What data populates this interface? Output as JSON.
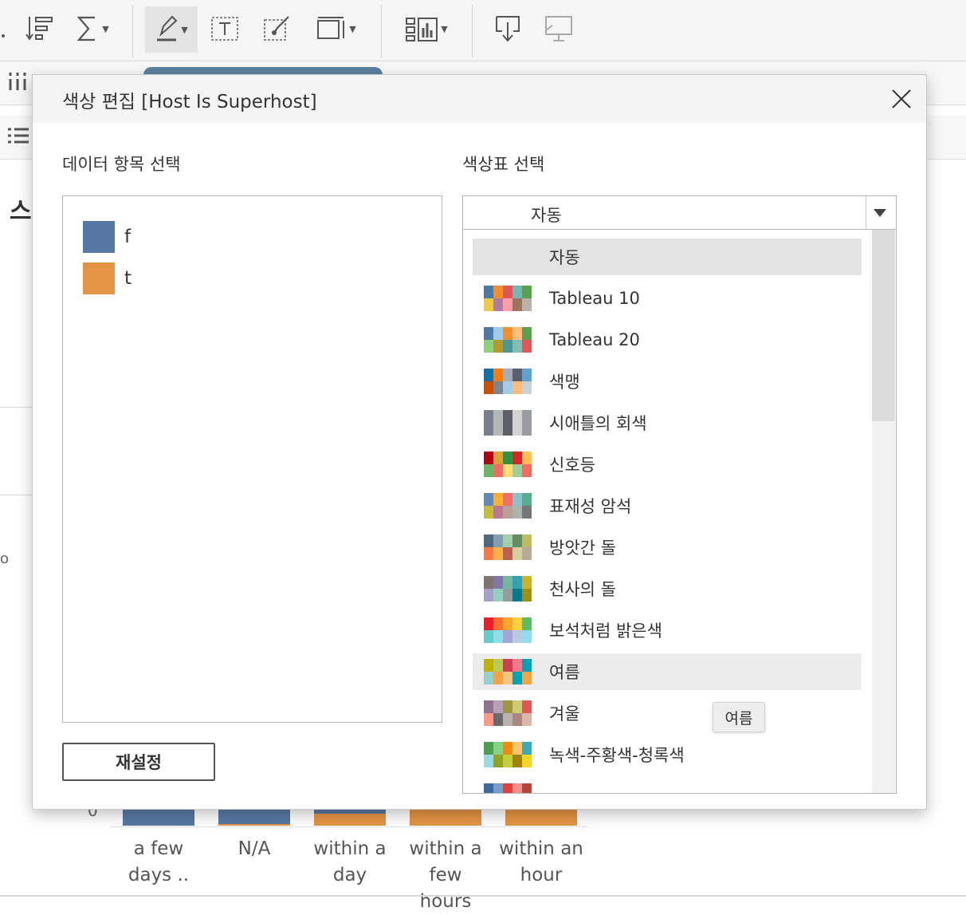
{
  "background": {
    "sheet_heading_partial": "스",
    "side_fragment": "o",
    "chart_zero": "0",
    "x_labels": [
      {
        "line1": "a few",
        "line2": "days .."
      },
      {
        "line1": "N/A",
        "line2": ""
      },
      {
        "line1": "within a",
        "line2": "day"
      },
      {
        "line1": "within a",
        "line2": "few hours"
      },
      {
        "line1": "within an",
        "line2": "hour"
      }
    ],
    "colors": {
      "f": "#5778a4",
      "t": "#e49444"
    }
  },
  "dialog": {
    "title": "색상 편집 [Host Is Superhost]",
    "data_items_label": "데이터 항목 선택",
    "palette_label": "색상표 선택",
    "items": [
      {
        "label": "f",
        "color": "#5778a4"
      },
      {
        "label": "t",
        "color": "#e49444"
      }
    ],
    "reset_label": "재설정",
    "selected_palette": "자동",
    "palettes": [
      {
        "label": "자동",
        "colors": []
      },
      {
        "label": "Tableau 10",
        "colors": [
          "#4e79a7",
          "#f28e2b",
          "#e15759",
          "#76b7b2",
          "#59a14f",
          "#edc948",
          "#b07aa1",
          "#ff9da7",
          "#9c755f",
          "#bab0ac"
        ]
      },
      {
        "label": "Tableau 20",
        "colors": [
          "#4e79a7",
          "#a0cbe8",
          "#f28e2b",
          "#ffbe7d",
          "#59a14f",
          "#8cd17d",
          "#b6992d",
          "#499894",
          "#86bcb6",
          "#e15759"
        ]
      },
      {
        "label": "색맹",
        "colors": [
          "#1170aa",
          "#fc7d0b",
          "#a3acb9",
          "#57606c",
          "#5fa2ce",
          "#c85200",
          "#7b848f",
          "#a3cce9",
          "#ffbc79",
          "#c8d0d9"
        ]
      },
      {
        "label": "시애틀의 회색",
        "colors": [
          "#767f8b",
          "#b3b7b8",
          "#5c6068",
          "#d3d3d3",
          "#989ca3",
          "#767f8b",
          "#b3b7b8",
          "#5c6068",
          "#d3d3d3",
          "#989ca3"
        ]
      },
      {
        "label": "신호등",
        "colors": [
          "#b10318",
          "#dba13a",
          "#309343",
          "#d82526",
          "#ffc156",
          "#69b764",
          "#f26c64",
          "#ffdd71",
          "#9fcd99",
          "#f26c64"
        ]
      },
      {
        "label": "표재성 암석",
        "colors": [
          "#6388b4",
          "#ffae34",
          "#ef6f6a",
          "#8cc2ca",
          "#55ad89",
          "#c3bc3f",
          "#bb7693",
          "#baa094",
          "#a9b5ae",
          "#767676"
        ]
      },
      {
        "label": "방앗간 돌",
        "colors": [
          "#4f6980",
          "#849db1",
          "#a2ceaa",
          "#638b66",
          "#bfbb60",
          "#f47942",
          "#fbb04e",
          "#b66353",
          "#d7ce9f",
          "#b9aa97"
        ]
      },
      {
        "label": "천사의 돌",
        "colors": [
          "#7e756d",
          "#8175aa",
          "#6fb899",
          "#31a1b3",
          "#ccb22b",
          "#a39fc9",
          "#94d0c0",
          "#959c9e",
          "#027b8e",
          "#9f8f12"
        ]
      },
      {
        "label": "보석처럼 밝은색",
        "colors": [
          "#eb1e2c",
          "#fd6f30",
          "#f9a729",
          "#f9d23c",
          "#5fbb68",
          "#64cdcc",
          "#91dcea",
          "#a4a4d5",
          "#bbc9e5",
          "#91dcea"
        ]
      },
      {
        "label": "여름",
        "colors": [
          "#bfb202",
          "#b9ca5d",
          "#cf3e53",
          "#f1788d",
          "#00a2b3",
          "#97cfd0",
          "#f3a546",
          "#f7c480",
          "#00a2b3",
          "#f3a546"
        ]
      },
      {
        "label": "겨울",
        "colors": [
          "#90728f",
          "#b9a0b4",
          "#9d983d",
          "#cecb76",
          "#e15759",
          "#ff9888",
          "#6b6b6b",
          "#bab2ae",
          "#aa8780",
          "#dab6af"
        ]
      },
      {
        "label": "녹색-주황색-청록색",
        "colors": [
          "#4e9f50",
          "#87d180",
          "#ef8a0c",
          "#fcc66d",
          "#3ca8bc",
          "#98d9e4",
          "#94a323",
          "#c3ce3d",
          "#a08400",
          "#f7d42a"
        ]
      },
      {
        "label": "",
        "colors": [
          "#3b6aa0",
          "#7a9cc4",
          "#e0413a",
          "#f28e8b",
          "#b4453a",
          "#3b6aa0",
          "#7a9cc4",
          "#e0413a",
          "#f28e8b",
          "#b4453a"
        ]
      }
    ],
    "hovered_palette": "여름",
    "tooltip": "여름"
  }
}
